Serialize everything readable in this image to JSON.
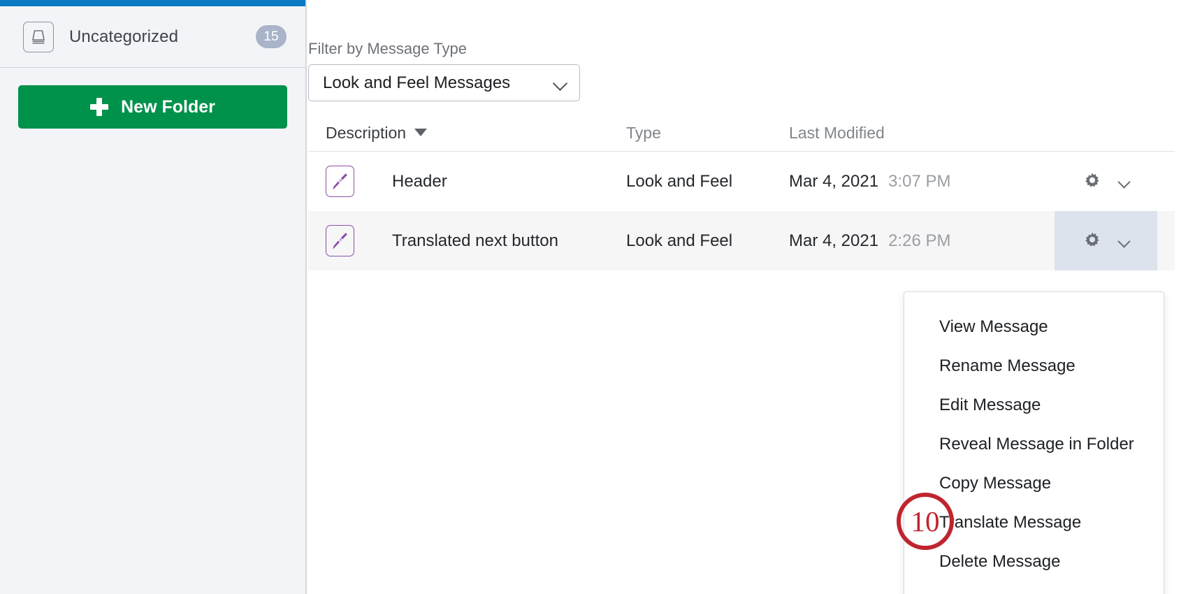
{
  "sidebar": {
    "accent_color": "#0a7ac2",
    "folders": [
      {
        "icon": "inbox-tray-icon",
        "label": "Uncategorized",
        "count": "15"
      }
    ],
    "new_folder_button": {
      "label": "New Folder",
      "icon": "plus-icon",
      "color": "#00914b"
    }
  },
  "main": {
    "filter": {
      "label": "Filter by Message Type",
      "selected": "Look and Feel Messages",
      "chevron_icon": "chevron-down-icon"
    },
    "table": {
      "columns": [
        {
          "key": "description",
          "label": "Description",
          "sorted": true,
          "sort_icon": "sort-descending-caret"
        },
        {
          "key": "type",
          "label": "Type",
          "sorted": false
        },
        {
          "key": "last_modified",
          "label": "Last Modified",
          "sorted": false
        }
      ],
      "rows": [
        {
          "icon": "paintbrush-icon",
          "description": "Header",
          "type": "Look and Feel",
          "date": "Mar 4, 2021",
          "time": "3:07 PM",
          "gear_icon": "gear-icon",
          "chevron_icon": "chevron-down-icon",
          "highlighted": false,
          "actions_active": false
        },
        {
          "icon": "paintbrush-icon",
          "description": "Translated next button",
          "type": "Look and Feel",
          "date": "Mar 4, 2021",
          "time": "2:26 PM",
          "gear_icon": "gear-icon",
          "chevron_icon": "chevron-down-icon",
          "highlighted": true,
          "actions_active": true
        }
      ]
    }
  },
  "context_menu": {
    "items": [
      {
        "label": "View Message"
      },
      {
        "label": "Rename Message"
      },
      {
        "label": "Edit Message"
      },
      {
        "label": "Reveal Message in Folder"
      },
      {
        "label": "Copy Message"
      },
      {
        "label": "Translate Message"
      },
      {
        "label": "Delete Message"
      }
    ]
  },
  "annotation": {
    "number": "10",
    "color": "#c0242f",
    "targets": "Translate Message"
  }
}
